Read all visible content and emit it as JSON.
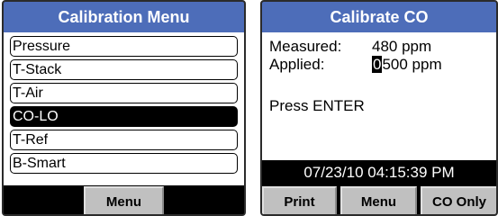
{
  "calibration_menu": {
    "title": "Calibration Menu",
    "items": [
      {
        "label": "Pressure"
      },
      {
        "label": "T-Stack"
      },
      {
        "label": "T-Air"
      },
      {
        "label": "CO-LO",
        "selected": true
      },
      {
        "label": "T-Ref"
      },
      {
        "label": "B-Smart"
      }
    ],
    "softkey_label": "Menu"
  },
  "calibrate_co": {
    "title": "Calibrate CO",
    "measured_label": "Measured:",
    "measured_value": "480 ppm",
    "applied_label": "Applied:",
    "applied_cursor_digit": "0",
    "applied_value_rest": "500 ppm",
    "prompt": "Press ENTER",
    "datetime": "07/23/10 04:15:39 PM",
    "softkeys": {
      "print": "Print",
      "menu": "Menu",
      "co_only": "CO Only"
    }
  },
  "colors": {
    "title_bar": "#4d6db9",
    "selected_background": "#000000",
    "softkey_background": "#c0c0c0"
  }
}
